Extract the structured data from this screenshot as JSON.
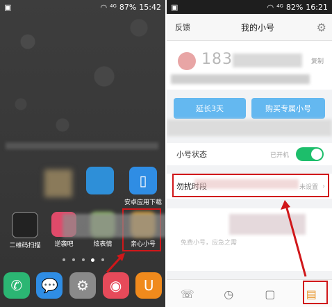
{
  "left_phone": {
    "status": {
      "signal": "⁴ᴳ",
      "battery": "87%",
      "time": "15:42"
    },
    "grid_labels": [
      "二维码扫描",
      "逆袭吧",
      "炫表情",
      "亲心小号"
    ],
    "row2_labels": [
      "安卓应用下载"
    ],
    "dock_icons": [
      "phone-icon",
      "message-icon",
      "settings-icon",
      "camera-icon",
      "uc-browser-icon"
    ]
  },
  "right_phone": {
    "status": {
      "signal": "⁴ᴳ",
      "battery": "82%",
      "time": "16:21"
    },
    "header": {
      "left": "反馈",
      "title": "我的小号"
    },
    "account": {
      "number_prefix": "183",
      "copy": "复制"
    },
    "buttons": {
      "extend": "延长3天",
      "buy": "购买专属小号"
    },
    "status_row": {
      "label": "小号状态",
      "value": "已开机"
    },
    "dnd_row": {
      "label": "勿扰时段",
      "value": "未设置"
    },
    "notice": "免费小号，应急之需"
  },
  "colors": {
    "accent_red": "#d0171a",
    "toggle_green": "#1dbe6b",
    "button_blue": "#64b8f0"
  }
}
